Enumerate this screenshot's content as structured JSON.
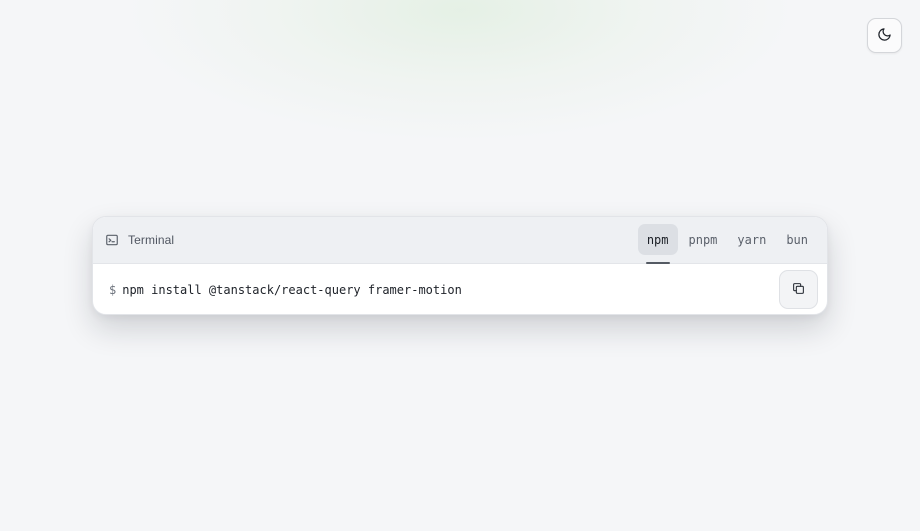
{
  "theme_toggle": {
    "icon": "moon-icon"
  },
  "terminal": {
    "icon": "terminal-icon",
    "title": "Terminal",
    "tabs": [
      {
        "label": "npm",
        "active": true
      },
      {
        "label": "pnpm",
        "active": false
      },
      {
        "label": "yarn",
        "active": false
      },
      {
        "label": "bun",
        "active": false
      }
    ],
    "prompt": "$",
    "command": "npm install @tanstack/react-query framer-motion",
    "copy_icon": "copy-icon"
  },
  "colors": {
    "background": "#f5f6f8",
    "header_background": "#eef0f3",
    "active_tab_background": "#dcdfe4",
    "active_tab_indicator": "#545a63",
    "text_primary": "#1d2128",
    "text_secondary": "#5b616b"
  }
}
